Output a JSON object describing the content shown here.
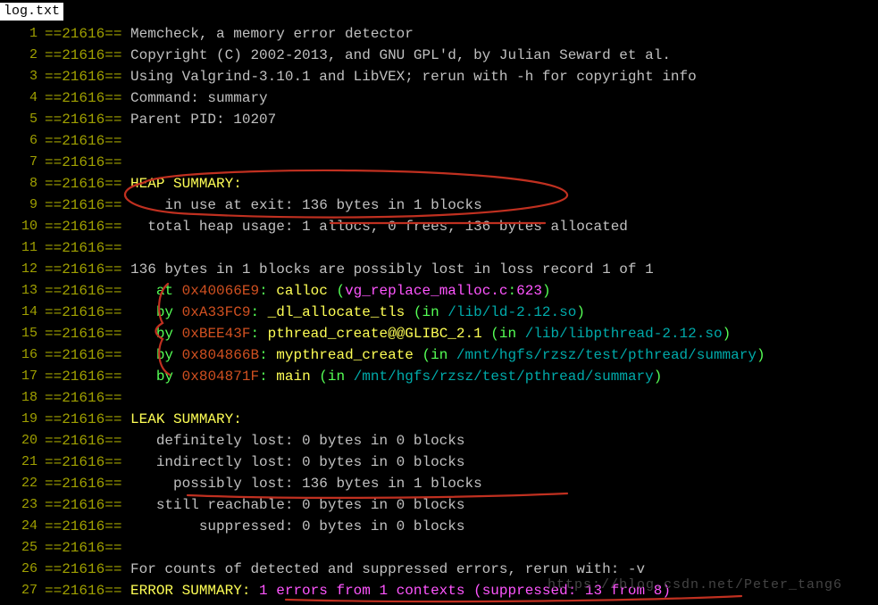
{
  "tab": {
    "filename": "log.txt"
  },
  "pid_tag": "==21616==",
  "lines": [
    {
      "num": 1,
      "segs": [
        {
          "c": "olive",
          "t": "==21616== "
        },
        {
          "c": "silver",
          "t": "Memcheck, a memory error detector"
        }
      ]
    },
    {
      "num": 2,
      "segs": [
        {
          "c": "olive",
          "t": "==21616== "
        },
        {
          "c": "silver",
          "t": "Copyright (C) 2002-2013, and GNU GPL'd, by Julian Seward et al."
        }
      ]
    },
    {
      "num": 3,
      "segs": [
        {
          "c": "olive",
          "t": "==21616== "
        },
        {
          "c": "silver",
          "t": "Using Valgrind-3.10.1 and LibVEX; rerun with -h for copyright info"
        }
      ]
    },
    {
      "num": 4,
      "segs": [
        {
          "c": "olive",
          "t": "==21616== "
        },
        {
          "c": "silver",
          "t": "Command: summary"
        }
      ]
    },
    {
      "num": 5,
      "segs": [
        {
          "c": "olive",
          "t": "==21616== "
        },
        {
          "c": "silver",
          "t": "Parent PID: 10207"
        }
      ]
    },
    {
      "num": 6,
      "segs": [
        {
          "c": "olive",
          "t": "==21616=="
        }
      ]
    },
    {
      "num": 7,
      "segs": [
        {
          "c": "olive",
          "t": "==21616=="
        }
      ]
    },
    {
      "num": 8,
      "segs": [
        {
          "c": "olive",
          "t": "==21616== "
        },
        {
          "c": "yellow",
          "t": "HEAP SUMMARY:"
        }
      ]
    },
    {
      "num": 9,
      "segs": [
        {
          "c": "olive",
          "t": "==21616== "
        },
        {
          "c": "silver",
          "t": "    in use at exit: 136 bytes in 1 blocks"
        }
      ]
    },
    {
      "num": 10,
      "segs": [
        {
          "c": "olive",
          "t": "==21616== "
        },
        {
          "c": "silver",
          "t": "  total heap usage: 1 allocs, 0 frees, 136 bytes allocated"
        }
      ]
    },
    {
      "num": 11,
      "segs": [
        {
          "c": "olive",
          "t": "==21616=="
        }
      ]
    },
    {
      "num": 12,
      "segs": [
        {
          "c": "olive",
          "t": "==21616== "
        },
        {
          "c": "silver",
          "t": "136 bytes in 1 blocks are possibly lost in loss record 1 of 1"
        }
      ]
    },
    {
      "num": 13,
      "segs": [
        {
          "c": "olive",
          "t": "==21616==    "
        },
        {
          "c": "green",
          "t": "at "
        },
        {
          "c": "orange",
          "t": "0x40066E9"
        },
        {
          "c": "green",
          "t": ": "
        },
        {
          "c": "yellow",
          "t": "calloc"
        },
        {
          "c": "green",
          "t": " ("
        },
        {
          "c": "magenta",
          "t": "vg_replace_malloc.c"
        },
        {
          "c": "green",
          "t": ":"
        },
        {
          "c": "magenta",
          "t": "623"
        },
        {
          "c": "green",
          "t": ")"
        }
      ]
    },
    {
      "num": 14,
      "segs": [
        {
          "c": "olive",
          "t": "==21616==    "
        },
        {
          "c": "green",
          "t": "by "
        },
        {
          "c": "orange",
          "t": "0xA33FC9"
        },
        {
          "c": "green",
          "t": ": "
        },
        {
          "c": "yellow",
          "t": "_dl_allocate_tls"
        },
        {
          "c": "green",
          "t": " (in "
        },
        {
          "c": "cyan",
          "t": "/lib/ld-2.12.so"
        },
        {
          "c": "green",
          "t": ")"
        }
      ]
    },
    {
      "num": 15,
      "segs": [
        {
          "c": "olive",
          "t": "==21616==    "
        },
        {
          "c": "green",
          "t": "by "
        },
        {
          "c": "orange",
          "t": "0xBEE43F"
        },
        {
          "c": "green",
          "t": ": "
        },
        {
          "c": "yellow",
          "t": "pthread_create@@GLIBC_2.1"
        },
        {
          "c": "green",
          "t": " (in "
        },
        {
          "c": "cyan",
          "t": "/lib/libpthread-2.12.so"
        },
        {
          "c": "green",
          "t": ")"
        }
      ]
    },
    {
      "num": 16,
      "segs": [
        {
          "c": "olive",
          "t": "==21616==    "
        },
        {
          "c": "green",
          "t": "by "
        },
        {
          "c": "orange",
          "t": "0x804866B"
        },
        {
          "c": "green",
          "t": ": "
        },
        {
          "c": "yellow",
          "t": "mypthread_create"
        },
        {
          "c": "green",
          "t": " (in "
        },
        {
          "c": "cyan",
          "t": "/mnt/hgfs/rzsz/test/pthread/summary"
        },
        {
          "c": "green",
          "t": ")"
        }
      ]
    },
    {
      "num": 17,
      "segs": [
        {
          "c": "olive",
          "t": "==21616==    "
        },
        {
          "c": "green",
          "t": "by "
        },
        {
          "c": "orange",
          "t": "0x804871F"
        },
        {
          "c": "green",
          "t": ": "
        },
        {
          "c": "yellow",
          "t": "main"
        },
        {
          "c": "green",
          "t": " (in "
        },
        {
          "c": "cyan",
          "t": "/mnt/hgfs/rzsz/test/pthread/summary"
        },
        {
          "c": "green",
          "t": ")"
        }
      ]
    },
    {
      "num": 18,
      "segs": [
        {
          "c": "olive",
          "t": "==21616=="
        }
      ]
    },
    {
      "num": 19,
      "segs": [
        {
          "c": "olive",
          "t": "==21616== "
        },
        {
          "c": "yellow",
          "t": "LEAK SUMMARY:"
        }
      ]
    },
    {
      "num": 20,
      "segs": [
        {
          "c": "olive",
          "t": "==21616== "
        },
        {
          "c": "silver",
          "t": "   definitely lost: 0 bytes in 0 blocks"
        }
      ]
    },
    {
      "num": 21,
      "segs": [
        {
          "c": "olive",
          "t": "==21616== "
        },
        {
          "c": "silver",
          "t": "   indirectly lost: 0 bytes in 0 blocks"
        }
      ]
    },
    {
      "num": 22,
      "segs": [
        {
          "c": "olive",
          "t": "==21616== "
        },
        {
          "c": "silver",
          "t": "     possibly lost: 136 bytes in 1 blocks"
        }
      ]
    },
    {
      "num": 23,
      "segs": [
        {
          "c": "olive",
          "t": "==21616== "
        },
        {
          "c": "silver",
          "t": "   still reachable: 0 bytes in 0 blocks"
        }
      ]
    },
    {
      "num": 24,
      "segs": [
        {
          "c": "olive",
          "t": "==21616== "
        },
        {
          "c": "silver",
          "t": "        suppressed: 0 bytes in 0 blocks"
        }
      ]
    },
    {
      "num": 25,
      "segs": [
        {
          "c": "olive",
          "t": "==21616=="
        }
      ]
    },
    {
      "num": 26,
      "segs": [
        {
          "c": "olive",
          "t": "==21616== "
        },
        {
          "c": "silver",
          "t": "For counts of detected and suppressed errors, rerun with: -v"
        }
      ]
    },
    {
      "num": 27,
      "segs": [
        {
          "c": "olive",
          "t": "==21616== "
        },
        {
          "c": "yellow",
          "t": "ERROR SUMMARY: "
        },
        {
          "c": "magenta",
          "t": "1 errors from 1 contexts (suppressed: 13 from 8)"
        }
      ]
    }
  ],
  "watermark": "https://blog.csdn.net/Peter_tang6"
}
